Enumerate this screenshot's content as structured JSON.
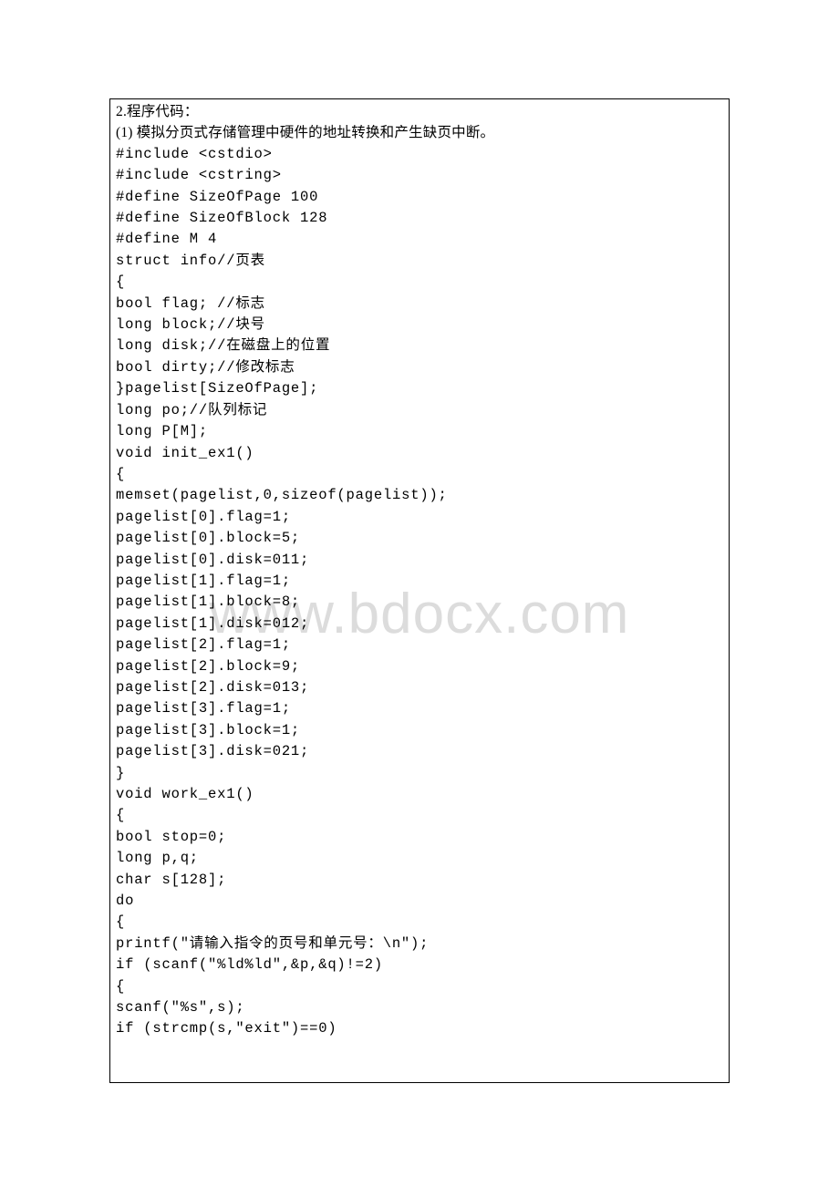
{
  "watermark": "www.bdocx.com",
  "lines": [
    {
      "cls": "",
      "text": "2.程序代码："
    },
    {
      "cls": "",
      "text": "(1) 模拟分页式存储管理中硬件的地址转换和产生缺页中断。"
    },
    {
      "cls": "mono",
      "text": "#include <cstdio>"
    },
    {
      "cls": "mono",
      "text": "#include <cstring>"
    },
    {
      "cls": "mono",
      "text": "#define SizeOfPage 100"
    },
    {
      "cls": "mono",
      "text": "#define SizeOfBlock 128"
    },
    {
      "cls": "mono",
      "text": "#define M 4"
    },
    {
      "cls": "mono",
      "text": "struct info//页表"
    },
    {
      "cls": "mono",
      "text": "{"
    },
    {
      "cls": "mono",
      "text": "bool flag; //标志"
    },
    {
      "cls": "mono",
      "text": "long block;//块号"
    },
    {
      "cls": "mono",
      "text": "long disk;//在磁盘上的位置"
    },
    {
      "cls": "mono",
      "text": "bool dirty;//修改标志"
    },
    {
      "cls": "mono",
      "text": "}pagelist[SizeOfPage];"
    },
    {
      "cls": "mono",
      "text": "long po;//队列标记"
    },
    {
      "cls": "mono",
      "text": "long P[M];"
    },
    {
      "cls": "mono",
      "text": "void init_ex1()"
    },
    {
      "cls": "mono",
      "text": "{"
    },
    {
      "cls": "mono",
      "text": "memset(pagelist,0,sizeof(pagelist));"
    },
    {
      "cls": "mono",
      "text": "pagelist[0].flag=1;"
    },
    {
      "cls": "mono",
      "text": "pagelist[0].block=5;"
    },
    {
      "cls": "mono",
      "text": "pagelist[0].disk=011;"
    },
    {
      "cls": "mono",
      "text": "pagelist[1].flag=1;"
    },
    {
      "cls": "mono",
      "text": "pagelist[1].block=8;"
    },
    {
      "cls": "mono",
      "text": "pagelist[1].disk=012;"
    },
    {
      "cls": "mono",
      "text": "pagelist[2].flag=1;"
    },
    {
      "cls": "mono",
      "text": "pagelist[2].block=9;"
    },
    {
      "cls": "mono",
      "text": "pagelist[2].disk=013;"
    },
    {
      "cls": "mono",
      "text": "pagelist[3].flag=1;"
    },
    {
      "cls": "mono",
      "text": "pagelist[3].block=1;"
    },
    {
      "cls": "mono",
      "text": "pagelist[3].disk=021;"
    },
    {
      "cls": "mono",
      "text": "}"
    },
    {
      "cls": "mono",
      "text": "void work_ex1()"
    },
    {
      "cls": "mono",
      "text": "{"
    },
    {
      "cls": "mono",
      "text": "bool stop=0;"
    },
    {
      "cls": "mono",
      "text": "long p,q;"
    },
    {
      "cls": "mono",
      "text": "char s[128];"
    },
    {
      "cls": "mono",
      "text": "do"
    },
    {
      "cls": "mono",
      "text": "{"
    },
    {
      "cls": "mono",
      "text": "printf(\"请输入指令的页号和单元号：\\n\");"
    },
    {
      "cls": "mono",
      "text": "if (scanf(\"%ld%ld\",&p,&q)!=2)"
    },
    {
      "cls": "mono",
      "text": "{"
    },
    {
      "cls": "mono",
      "text": "scanf(\"%s\",s);"
    },
    {
      "cls": "mono",
      "text": "if (strcmp(s,\"exit\")==0)"
    }
  ]
}
